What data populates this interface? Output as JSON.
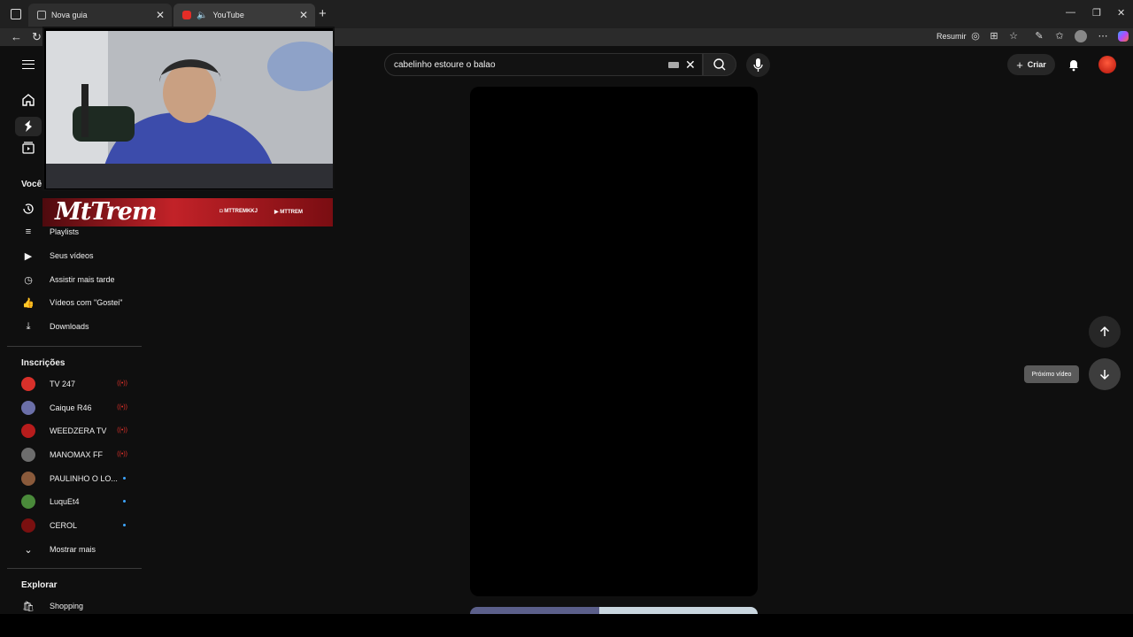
{
  "browser": {
    "tabs": [
      {
        "title": "Nova guia"
      },
      {
        "title": "YouTube"
      }
    ],
    "toolbar": {
      "summarize_label": "Resumir"
    }
  },
  "youtube": {
    "search": {
      "query": "cabelinho estoure o balao"
    },
    "header": {
      "create_label": "Criar"
    },
    "sidebar": {
      "you_section": "Você",
      "you_items": [
        {
          "label": "Playlists",
          "icon": "playlist-icon"
        },
        {
          "label": "Seus vídeos",
          "icon": "video-icon"
        },
        {
          "label": "Assistir mais tarde",
          "icon": "clock-icon"
        },
        {
          "label": "Vídeos com \"Gostei\"",
          "icon": "thumb-up-icon"
        },
        {
          "label": "Downloads",
          "icon": "download-icon"
        }
      ],
      "subs_section": "Inscrições",
      "subscriptions": [
        {
          "name": "TV 247",
          "status": "live",
          "color": "#d8302a"
        },
        {
          "name": "Caique R46",
          "status": "live",
          "color": "#6b6fa8"
        },
        {
          "name": "WEEDZERA TV",
          "status": "live",
          "color": "#b71c1c"
        },
        {
          "name": "MANOMAX FF",
          "status": "live",
          "color": "#6d6d6d"
        },
        {
          "name": "PAULINHO O LO...",
          "status": "new",
          "color": "#8a5a3b"
        },
        {
          "name": "LuquEt4",
          "status": "new",
          "color": "#4a8a3a"
        },
        {
          "name": "CEROL",
          "status": "new",
          "color": "#7a1010"
        }
      ],
      "show_more": "Mostrar mais",
      "explore_section": "Explorar",
      "explore_items": [
        {
          "label": "Shopping",
          "icon": "shopping-bag-icon"
        }
      ]
    },
    "shorts": {
      "next_tooltip": "Próximo vídeo"
    }
  },
  "overlay": {
    "logo": "MtTrem",
    "handles": [
      "MTTREMKKJ",
      "MTTREM"
    ]
  }
}
